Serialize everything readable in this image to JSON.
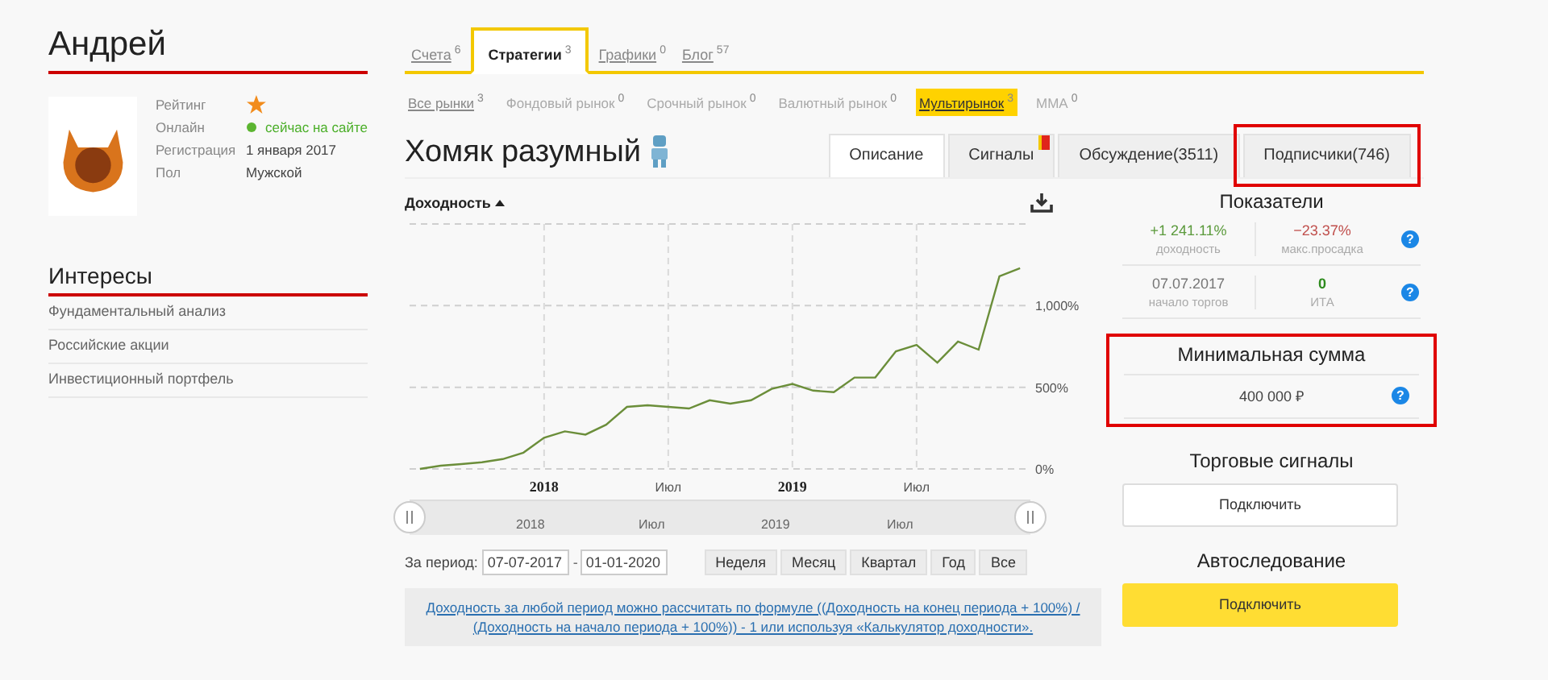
{
  "profile": {
    "name": "Андрей",
    "fields": [
      {
        "label": "Рейтинг",
        "kind": "star"
      },
      {
        "label": "Онлайн",
        "kind": "online",
        "value": "сейчас на сайте",
        "online": true
      },
      {
        "label": "Регистрация",
        "kind": "text",
        "value": "1 января 2017"
      },
      {
        "label": "Пол",
        "kind": "text",
        "value": "Мужской"
      }
    ]
  },
  "interests": {
    "title": "Интересы",
    "items": [
      "Фундаментальный анализ",
      "Российские акции",
      "Инвестиционный портфель"
    ]
  },
  "tabs": [
    {
      "label": "Счета",
      "count": "6",
      "selected": false
    },
    {
      "label": "Стратегии",
      "count": "3",
      "selected": true
    },
    {
      "label": "Графики",
      "count": "0",
      "selected": false
    },
    {
      "label": "Блог",
      "count": "57",
      "selected": false
    }
  ],
  "market_filters": [
    {
      "label": "Все рынки",
      "count": "3",
      "selected": false,
      "disabled": false
    },
    {
      "label": "Фондовый рынок",
      "count": "0",
      "selected": false,
      "disabled": true
    },
    {
      "label": "Срочный рынок",
      "count": "0",
      "selected": false,
      "disabled": true
    },
    {
      "label": "Валютный рынок",
      "count": "0",
      "selected": false,
      "disabled": true
    },
    {
      "label": "Мультирынок",
      "count": "3",
      "selected": true,
      "disabled": false
    },
    {
      "label": "ММА",
      "count": "0",
      "selected": false,
      "disabled": true
    }
  ],
  "strategy": {
    "title": "Хомяк разумный",
    "tabs": [
      {
        "label": "Описание",
        "selected": true,
        "flag": false,
        "highlighted": false
      },
      {
        "label": "Сигналы",
        "selected": false,
        "flag": true,
        "highlighted": false
      },
      {
        "label": "Обсуждение(3511)",
        "selected": false,
        "flag": false,
        "highlighted": false
      },
      {
        "label": "Подписчики(746)",
        "selected": false,
        "flag": false,
        "highlighted": true
      }
    ]
  },
  "chart": {
    "sort_label": "Доходность",
    "chart_data": {
      "type": "line",
      "categories": [
        null,
        null,
        null,
        null,
        null,
        null,
        "2018",
        null,
        null,
        null,
        null,
        null,
        "Июл",
        null,
        null,
        null,
        null,
        null,
        "2019",
        null,
        null,
        null,
        null,
        null,
        "Июл",
        null,
        null,
        null,
        null,
        null
      ],
      "series": [
        {
          "color": "#6b8e3a",
          "values": [
            0,
            20,
            30,
            40,
            60,
            100,
            190,
            230,
            210,
            270,
            380,
            390,
            380,
            370,
            420,
            400,
            420,
            490,
            520,
            480,
            470,
            560,
            560,
            720,
            760,
            650,
            780,
            730,
            1180,
            1230
          ]
        }
      ],
      "ylim": [
        0,
        1500
      ],
      "grid": true,
      "yticks": [
        {
          "value": 0,
          "label": "0%"
        },
        {
          "value": 500,
          "label": "500%"
        },
        {
          "value": 1000,
          "label": "1,000%"
        }
      ]
    },
    "navigator_labels": [
      "2018",
      "Июл",
      "2019",
      "Июл"
    ],
    "period_label": "За период:",
    "date_from": "07-07-2017",
    "date_separator": "-",
    "date_to": "01-01-2020",
    "ranges": [
      "Неделя",
      "Месяц",
      "Квартал",
      "Год",
      "Все"
    ],
    "note": "Доходность за любой период можно рассчитать по формуле ((Доходность на конец периода + 100%) / (Доходность на начало периода + 100%)) - 1 или используя «Калькулятор доходности»."
  },
  "indicators": {
    "title": "Показатели",
    "rows": [
      {
        "metrics": [
          {
            "value": "+1 241.11%",
            "caption": "доходность",
            "color": "#5b9a3c"
          },
          {
            "value": "−23.37%",
            "caption": "макс.просадка",
            "color": "#c0504d"
          }
        ],
        "help": "?"
      },
      {
        "metrics": [
          {
            "value": "07.07.2017",
            "caption": "начало торгов",
            "color": "#777777"
          },
          {
            "value": "0",
            "caption": "ИТА",
            "color": "#2e8b1e"
          }
        ],
        "help": "?"
      }
    ]
  },
  "min_sum": {
    "title": "Минимальная сумма",
    "value": "400 000 ₽",
    "help": "?",
    "highlighted": true
  },
  "actions": [
    {
      "title": "Торговые сигналы",
      "button": "Подключить",
      "kind": "outline"
    },
    {
      "title": "Автоследование",
      "button": "Подключить",
      "kind": "primary"
    }
  ]
}
